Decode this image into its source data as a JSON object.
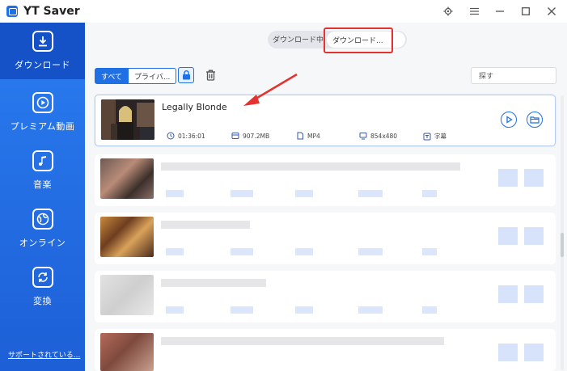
{
  "app": {
    "title": "YT Saver"
  },
  "window_controls": [
    {
      "name": "settings-gear-icon"
    },
    {
      "name": "menu-icon"
    },
    {
      "name": "minimize-icon"
    },
    {
      "name": "maximize-icon"
    },
    {
      "name": "close-icon"
    }
  ],
  "sidebar": {
    "items": [
      {
        "label": "ダウンロード",
        "icon": "download-icon",
        "active": true
      },
      {
        "label": "プレミアム動画",
        "icon": "play-icon",
        "active": false
      },
      {
        "label": "音楽",
        "icon": "music-icon",
        "active": false
      },
      {
        "label": "オンライン",
        "icon": "globe-icon",
        "active": false
      },
      {
        "label": "変換",
        "icon": "convert-icon",
        "active": false
      }
    ],
    "footer": "サポートされている..."
  },
  "tabs": {
    "downloading": "ダウンロード中",
    "downloaded": "ダウンロード..."
  },
  "filter": {
    "all": "すべて",
    "private": "プライバ..."
  },
  "search": {
    "placeholder": "探す"
  },
  "list": {
    "items": [
      {
        "title": "Legally Blonde",
        "duration": "01:36:01",
        "size": "907.2MB",
        "format": "MP4",
        "resolution": "854x480",
        "subtitle": "字幕"
      }
    ]
  },
  "colors": {
    "accent": "#1f6fe5",
    "sidebar": "#2a7cf0",
    "highlight": "#e4322e"
  }
}
